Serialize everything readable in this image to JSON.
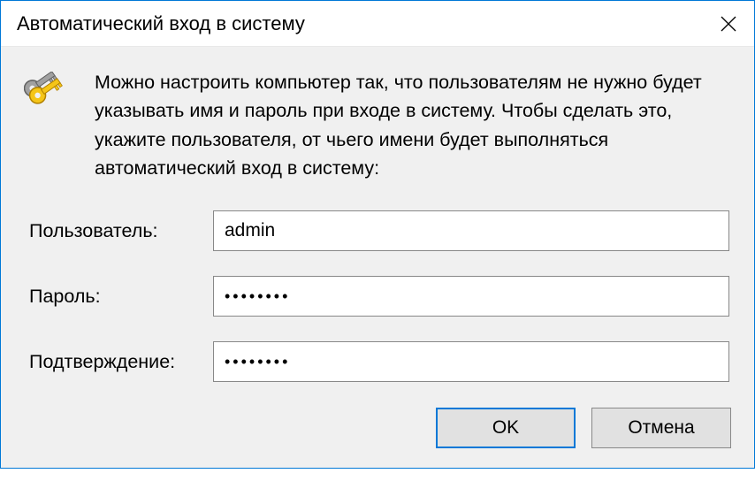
{
  "dialog": {
    "title": "Автоматический вход в систему",
    "description": "Можно настроить компьютер так, что пользователям не нужно будет указывать имя и пароль при входе в систему. Чтобы сделать это, укажите пользователя, от чьего имени будет выполняться автоматический вход в систему:",
    "fields": {
      "username": {
        "label": "Пользователь:",
        "value": "admin"
      },
      "password": {
        "label": "Пароль:",
        "value": "••••••••"
      },
      "confirm": {
        "label": "Подтверждение:",
        "value": "••••••••"
      }
    },
    "buttons": {
      "ok": "OK",
      "cancel": "Отмена"
    }
  }
}
